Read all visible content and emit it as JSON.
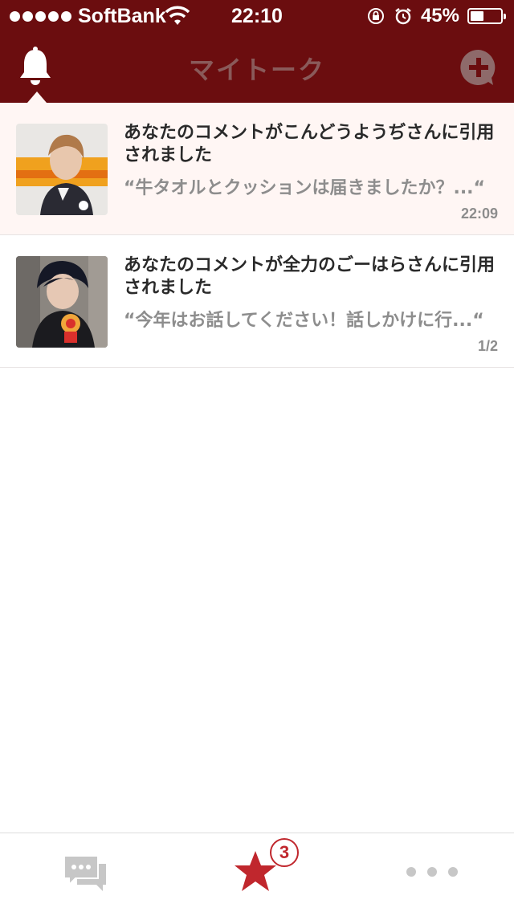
{
  "status_bar": {
    "carrier": "SoftBank",
    "time": "22:10",
    "battery_percent_label": "45%",
    "battery_level": 0.45
  },
  "nav": {
    "title": "マイトーク"
  },
  "notifications": [
    {
      "title": "あなたのコメントがこんどうようぢさんに引用されました",
      "quote": "“牛タオルとクッションは届きましたか？...“",
      "meta": "22:09",
      "unread": true
    },
    {
      "title": "あなたのコメントが全力のごーはらさんに引用されました",
      "quote": "“今年はお話してください！話しかけに行...“",
      "meta": "1/2",
      "unread": false
    }
  ],
  "tab_bar": {
    "badge_count": "3"
  },
  "colors": {
    "header_bg": "#6b0d0f",
    "unread_bg": "#fff6f4",
    "accent_red": "#c0272d",
    "muted_text": "#8d8d8d"
  }
}
